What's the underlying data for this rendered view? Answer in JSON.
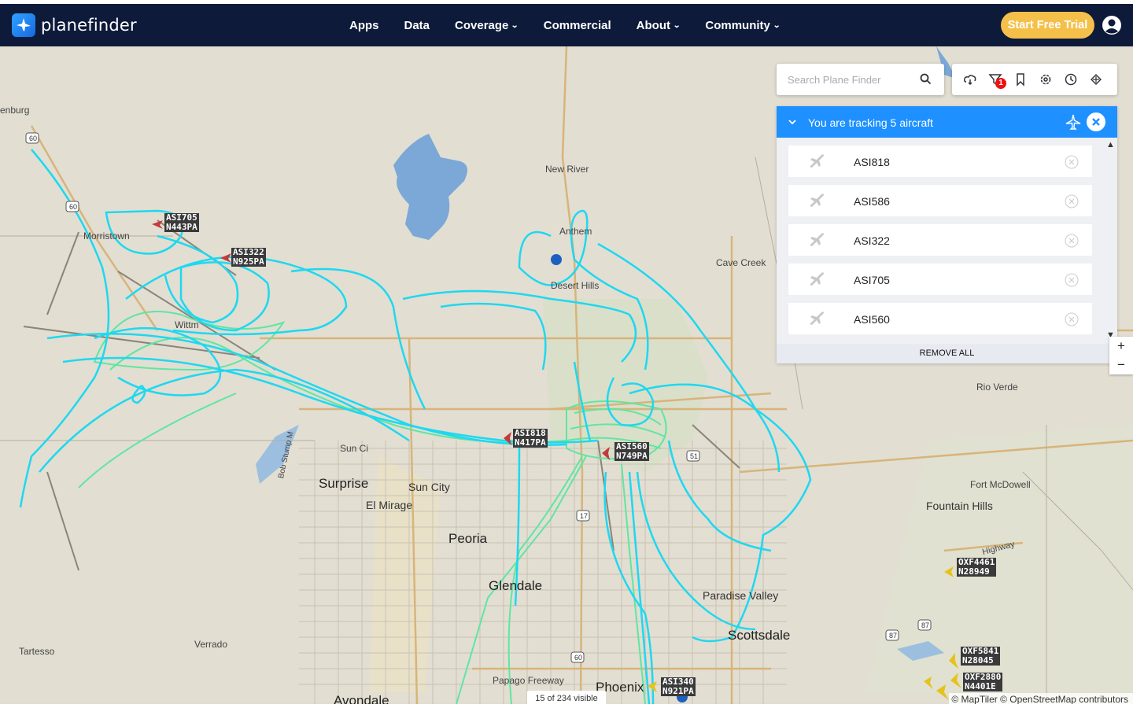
{
  "brand": {
    "name": "planefinder"
  },
  "nav": {
    "items": [
      {
        "label": "Apps",
        "dropdown": false
      },
      {
        "label": "Data",
        "dropdown": false
      },
      {
        "label": "Coverage",
        "dropdown": true
      },
      {
        "label": "Commercial",
        "dropdown": false
      },
      {
        "label": "About",
        "dropdown": true
      },
      {
        "label": "Community",
        "dropdown": true
      }
    ],
    "cta": "Start Free Trial"
  },
  "search": {
    "placeholder": "Search Plane Finder"
  },
  "toolbar": {
    "icons": [
      "weather-icon",
      "filter-icon",
      "bookmark-icon",
      "settings-icon",
      "history-icon",
      "playback-icon"
    ],
    "filter_badge": "1"
  },
  "tracking": {
    "title": "You are tracking 5 aircraft",
    "aircraft": [
      "ASI818",
      "ASI586",
      "ASI322",
      "ASI705",
      "ASI560"
    ],
    "remove_all": "REMOVE ALL"
  },
  "zoom": {
    "in": "+",
    "out": "−"
  },
  "map": {
    "places": [
      {
        "name": "Wickenburg",
        "text": "enburg",
        "size": "small"
      },
      {
        "name": "Morristown",
        "text": "Morristown",
        "size": "small"
      },
      {
        "name": "New River",
        "text": "New River",
        "size": "small"
      },
      {
        "name": "Anthem",
        "text": "Anthem",
        "size": "small"
      },
      {
        "name": "Desert Hills",
        "text": "Desert Hills",
        "size": "small"
      },
      {
        "name": "Cave Creek",
        "text": "Cave Creek",
        "size": "small"
      },
      {
        "name": "Wittmann",
        "text": "Wittm",
        "size": "small"
      },
      {
        "name": "Sun City West",
        "text": "Sun Ci",
        "size": "small"
      },
      {
        "name": "Rio Verde",
        "text": "Rio Verde",
        "size": "small"
      },
      {
        "name": "Surprise",
        "text": "Surprise",
        "size": "big"
      },
      {
        "name": "Sun City",
        "text": "Sun City",
        "size": "mid"
      },
      {
        "name": "El Mirage",
        "text": "El Mirage",
        "size": "mid"
      },
      {
        "name": "Fort McDowell",
        "text": "Fort McDowell",
        "size": "small"
      },
      {
        "name": "Fountain Hills",
        "text": "Fountain Hills",
        "size": "mid"
      },
      {
        "name": "Peoria",
        "text": "Peoria",
        "size": "big"
      },
      {
        "name": "Glendale",
        "text": "Glendale",
        "size": "big"
      },
      {
        "name": "Paradise Valley",
        "text": "Paradise Valley",
        "size": "mid"
      },
      {
        "name": "Scottsdale",
        "text": "Scottsdale",
        "size": "big"
      },
      {
        "name": "Tartesso",
        "text": "Tartesso",
        "size": "small"
      },
      {
        "name": "Verrado",
        "text": "Verrado",
        "size": "small"
      },
      {
        "name": "Papago Freeway",
        "text": "Papago Freeway",
        "size": "small"
      },
      {
        "name": "Phoenix",
        "text": "Phoenix",
        "size": "big"
      },
      {
        "name": "Avondale",
        "text": "Avondale",
        "size": "big"
      },
      {
        "name": "Bob Stump Memorial",
        "text": "Bob Stump M",
        "size": "small"
      },
      {
        "name": "Highway",
        "text": "Highway",
        "size": "small"
      }
    ],
    "route_shields": [
      "60",
      "60",
      "17",
      "51",
      "87",
      "87",
      "60"
    ],
    "aircraft_labels": [
      {
        "id": "ASI705",
        "reg": "N443PA"
      },
      {
        "id": "ASI322",
        "reg": "N925PA"
      },
      {
        "id": "ASI818",
        "reg": "N417PA"
      },
      {
        "id": "ASI560",
        "reg": "N749PA"
      },
      {
        "id": "ASI340",
        "reg": "N921PA"
      },
      {
        "id": "OXF4461",
        "reg": "N28949"
      },
      {
        "id": "OXF5841",
        "reg": "N28045"
      },
      {
        "id": "OXF2880",
        "reg": "N4401E"
      }
    ],
    "visible_count": "15 of 234 visible",
    "attribution": "© MapTiler © OpenStreetMap contributors"
  }
}
